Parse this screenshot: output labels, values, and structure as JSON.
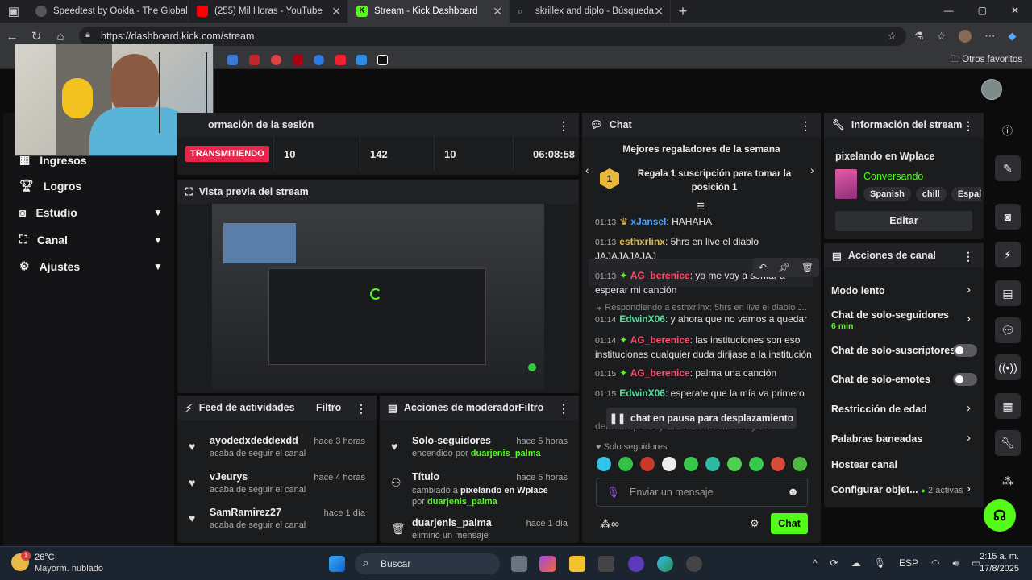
{
  "browser": {
    "tabs": [
      {
        "title": "Speedtest by Ookla - The Global",
        "color": "#444"
      },
      {
        "title": "(255) Mil Horas - YouTube",
        "color": "#ff0000"
      },
      {
        "title": "Stream - Kick Dashboard",
        "color": "#53fc18"
      },
      {
        "title": "skrillex and diplo - Búsqueda",
        "color": "#3a6ad6"
      }
    ],
    "url": "https://dashboard.kick.com/stream",
    "others_bookmarks": "Otros favoritos"
  },
  "sidebar": {
    "items": [
      {
        "label": "Ingresos"
      },
      {
        "label": "Logros"
      },
      {
        "label": "Estudio"
      },
      {
        "label": "Canal"
      },
      {
        "label": "Ajustes"
      }
    ]
  },
  "session": {
    "title": "ormación de la sesión",
    "status": "TRANSMITIENDO",
    "stats": [
      "10",
      "142",
      "10",
      "06:08:58"
    ]
  },
  "preview": {
    "title": "Vista previa del stream"
  },
  "activity_feed": {
    "title": "Feed de actividades",
    "filter": "Filtro",
    "items": [
      {
        "user": "ayodedxdeddexdd",
        "action": "acaba de seguir el canal",
        "time": "hace 3 horas"
      },
      {
        "user": "vJeurys",
        "action": "acaba de seguir el canal",
        "time": "hace 4 horas"
      },
      {
        "user": "SamRamirez27",
        "action": "acaba de seguir el canal",
        "time": "hace 1 día"
      }
    ]
  },
  "mod_actions": {
    "title": "Acciones de moderador",
    "filter": "Filtro",
    "items": [
      {
        "title": "Solo-seguidores",
        "pre": "encendido por",
        "who": "duarjenis_palma",
        "time": "hace 5 horas"
      },
      {
        "title": "Título",
        "pre": "cambiado a",
        "bold": "pixelando en Wplace",
        "mid": "por",
        "who": "duarjenis_palma",
        "time": "hace 5 horas"
      },
      {
        "title": "duarjenis_palma",
        "pre": "eliminó un mensaje",
        "time": "hace 1 día"
      }
    ]
  },
  "chat": {
    "title": "Chat",
    "gifters_title": "Mejores regaladores de la semana",
    "gift_rank": "1",
    "gift_text": "Regala 1 suscripción para tomar la posición 1",
    "messages": [
      {
        "ts": "01:13",
        "user": "xJansel",
        "color": "#4aa3ff",
        "text": ": HAHAHA"
      },
      {
        "ts": "01:13",
        "user": "esthxrlinx",
        "color": "#e0b95a",
        "text": ": 5hrs en live el diablo JAJAJAJAJAJ"
      },
      {
        "ts": "01:13",
        "user": "AG_berenice",
        "color": "#ff4d6d",
        "text": ": yo me voy a sentar a esperar mi canción"
      },
      {
        "reply": "Respondiendo a esthxrlinx: 5hrs en live el diablo J..."
      },
      {
        "ts": "01:14",
        "user": "EdwinX06",
        "color": "#53e0a0",
        "text": ": y ahora que no vamos a quedar"
      },
      {
        "ts": "01:14",
        "user": "AG_berenice",
        "color": "#ff4d6d",
        "text": ": las instituciones son eso instituciones cualquier duda dirijase a la institución"
      },
      {
        "ts": "01:15",
        "user": "AG_berenice",
        "color": "#ff4d6d",
        "text": ": palma una canción"
      },
      {
        "ts": "01:15",
        "user": "EdwinX06",
        "color": "#53e0a0",
        "text": ": esperate que la mía va primero"
      }
    ],
    "partial_msg": "dema... que soy un buen muchacho y un",
    "paused": "chat en pausa para desplazamiento",
    "followers_only": "Solo seguidores",
    "input_placeholder": "Enviar un mensaje",
    "send_label": "Chat"
  },
  "stream_info": {
    "title": "Información del stream",
    "stream_title": "pixelando en Wplace",
    "category": "Conversando",
    "tags": [
      "Spanish",
      "chill",
      "Españ"
    ],
    "edit_label": "Editar"
  },
  "channel_actions": {
    "title": "Acciones de canal",
    "rows": [
      {
        "label": "Modo lento",
        "kind": "chev"
      },
      {
        "label": "Chat de solo-seguidores",
        "sub": "6 min",
        "kind": "chev"
      },
      {
        "label": "Chat de solo-suscriptores",
        "kind": "toggle"
      },
      {
        "label": "Chat de solo-emotes",
        "kind": "toggle"
      },
      {
        "label": "Restricción de edad",
        "kind": "chev"
      },
      {
        "label": "Palabras baneadas",
        "kind": "chev"
      },
      {
        "label": "Hostear canal",
        "kind": "none"
      },
      {
        "label": "Configurar objet...",
        "badge": "2 activas",
        "kind": "chev"
      }
    ]
  },
  "taskbar": {
    "temp": "26°C",
    "weather": "Mayorm. nublado",
    "search": "Buscar",
    "lang": "ESP",
    "time": "2:15 a. m.",
    "date": "17/8/2025"
  }
}
